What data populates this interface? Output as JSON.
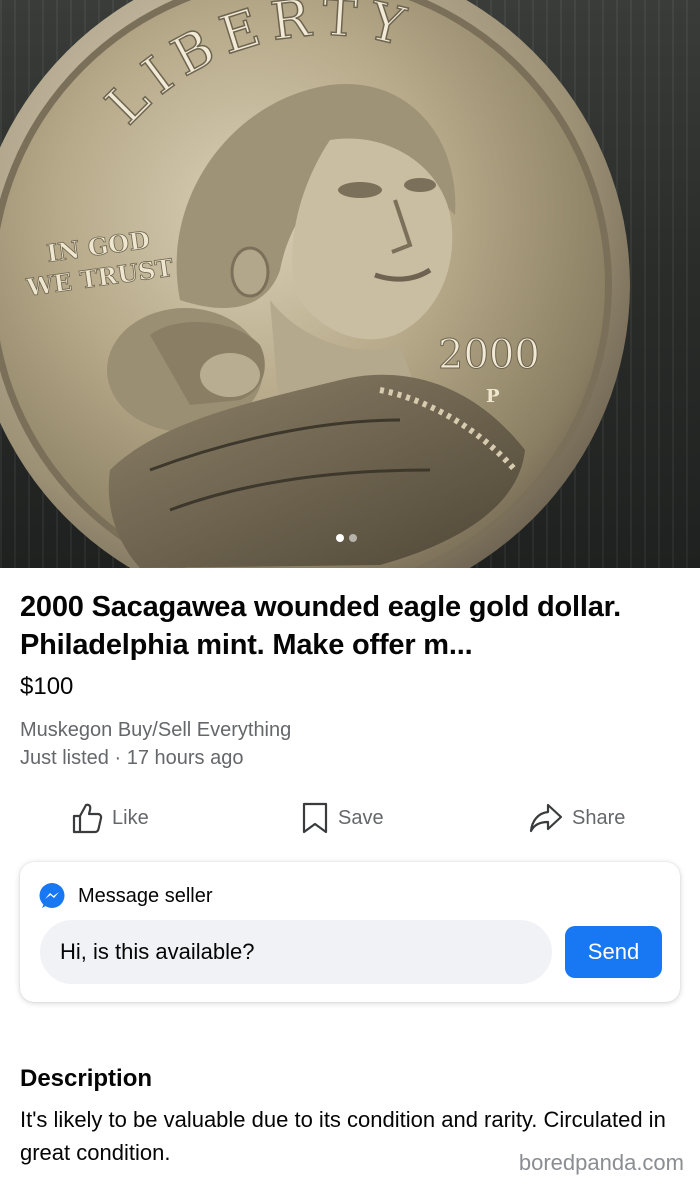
{
  "photo": {
    "coin_lettering": {
      "top": "LIBERTY",
      "motto_line1": "IN GOD",
      "motto_line2": "WE TRUST",
      "year": "2000",
      "mint_mark": "P"
    },
    "carousel": {
      "count": 2,
      "active_index": 0
    }
  },
  "listing": {
    "title": "2000 Sacagawea wounded eagle gold dollar. Philadelphia mint. Make offer m...",
    "price": "$100",
    "group": "Muskegon Buy/Sell Everything",
    "listed": "Just listed · 17 hours ago"
  },
  "actions": {
    "like": {
      "label": "Like",
      "icon": "thumbs-up-icon"
    },
    "save": {
      "label": "Save",
      "icon": "bookmark-icon"
    },
    "share": {
      "label": "Share",
      "icon": "share-arrow-icon"
    }
  },
  "message": {
    "title": "Message seller",
    "icon": "messenger-icon",
    "input_value": "Hi, is this available?",
    "send_label": "Send"
  },
  "description": {
    "heading": "Description",
    "text": "It's likely to be valuable due to its condition and rarity. Circulated in great condition."
  },
  "watermark": "boredpanda.com",
  "colors": {
    "accent": "#1877f2",
    "secondary_text": "#65676b",
    "input_bg": "#f0f2f5"
  }
}
